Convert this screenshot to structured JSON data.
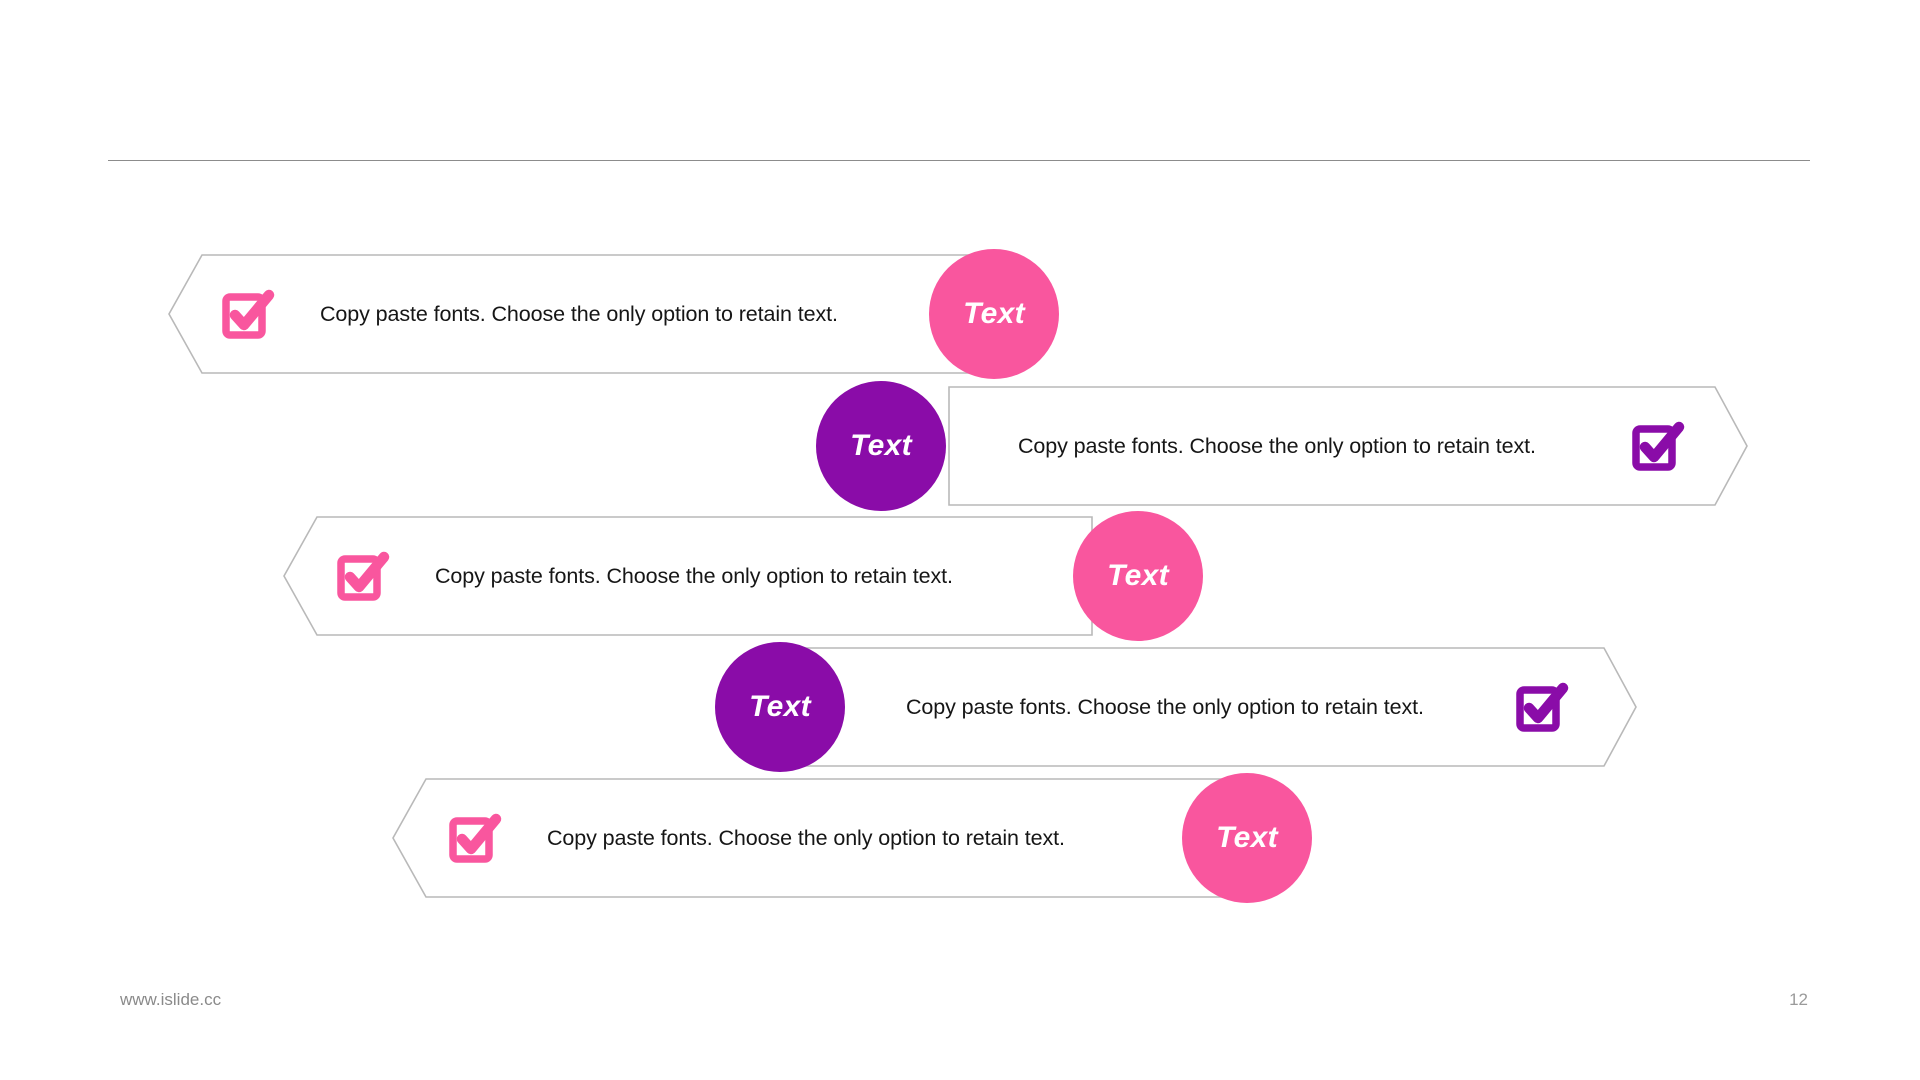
{
  "slide": {
    "background_color": "#ffffff",
    "divider_color": "#8c8c8c"
  },
  "colors": {
    "pink": "#F9569E",
    "purple": "#8A0CA8",
    "banner_border": "#b9b9b9",
    "banner_fill": "#ffffff",
    "body_text": "#161616",
    "footer_text": "#8a8a8a"
  },
  "rows": [
    {
      "index": 1,
      "accent": "pink",
      "accent_color": "#F9569E",
      "layout": "icon-left",
      "body_text": "Copy paste fonts. Choose the only option to retain text.",
      "circle_label": "Text",
      "icon": "checkbox-checked-icon"
    },
    {
      "index": 2,
      "accent": "purple",
      "accent_color": "#8A0CA8",
      "layout": "icon-right",
      "body_text": "Copy paste fonts. Choose the only option to retain text.",
      "circle_label": "Text",
      "icon": "checkbox-checked-icon"
    },
    {
      "index": 3,
      "accent": "pink",
      "accent_color": "#F9569E",
      "layout": "icon-left",
      "body_text": "Copy paste fonts. Choose the only option to retain text.",
      "circle_label": "Text",
      "icon": "checkbox-checked-icon"
    },
    {
      "index": 4,
      "accent": "purple",
      "accent_color": "#8A0CA8",
      "layout": "icon-right",
      "body_text": "Copy paste fonts. Choose the only option to retain text.",
      "circle_label": "Text",
      "icon": "checkbox-checked-icon"
    },
    {
      "index": 5,
      "accent": "pink",
      "accent_color": "#F9569E",
      "layout": "icon-left",
      "body_text": "Copy paste fonts. Choose the only option to retain text.",
      "circle_label": "Text",
      "icon": "checkbox-checked-icon"
    }
  ],
  "footer": {
    "site": "www.islide.cc",
    "page_number": "12"
  }
}
